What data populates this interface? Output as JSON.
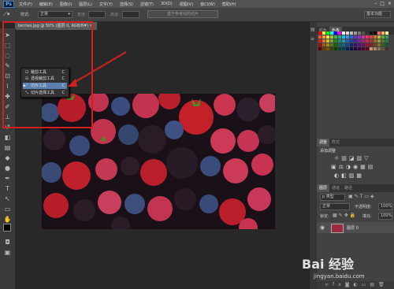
{
  "app": {
    "logo": "Ps"
  },
  "menu": [
    "文件(F)",
    "编辑(E)",
    "图像(I)",
    "图层(L)",
    "文字(Y)",
    "选择(S)",
    "滤镜(T)",
    "3D(D)",
    "视图(V)",
    "窗口(W)",
    "帮助(H)"
  ],
  "window_controls": [
    "–",
    "□",
    "×"
  ],
  "options": {
    "style_label": "样式:",
    "style_value": "正常",
    "width_label": "宽度:",
    "height_label": "高度:",
    "slices_button": "基于参考线的切片",
    "workspace_value": "基本功能"
  },
  "document_tab": {
    "title": "berries.jpg @ 50% (图层 0, RGB/8#) ×"
  },
  "tool_flyout": {
    "items": [
      {
        "label": "裁剪工具",
        "shortcut": "C",
        "icon": "crop-icon",
        "glyph": "⊡",
        "active": false,
        "selected": false
      },
      {
        "label": "透视裁剪工具",
        "shortcut": "C",
        "icon": "perspective-crop-icon",
        "glyph": "⊟",
        "active": false,
        "selected": false
      },
      {
        "label": "切片工具",
        "shortcut": "C",
        "icon": "slice-icon",
        "glyph": "⟋",
        "active": true,
        "selected": true
      },
      {
        "label": "切片选择工具",
        "shortcut": "C",
        "icon": "slice-select-icon",
        "glyph": "⤡",
        "active": false,
        "selected": false
      }
    ]
  },
  "panels": {
    "color_tabs": [
      "颜色",
      "色板"
    ],
    "adjust_tabs": [
      "调整",
      "样式"
    ],
    "adjust_title": "添加调整",
    "layers_tabs": [
      "图层",
      "通道",
      "路径"
    ],
    "kind_label": "p 类型",
    "blend_mode": "正常",
    "opacity_label": "不透明度:",
    "opacity_value": "100%",
    "lock_label": "锁定:",
    "fill_label": "填充:",
    "fill_value": "100%",
    "layer_name": "图层 0"
  },
  "watermark": {
    "brand": "Bai 经验",
    "url": "jingyan.baidu.com"
  },
  "colors": {
    "highlight": "#d02020",
    "selection": "#5b7fb0",
    "foreground": "#000000",
    "background": "#ffffff"
  }
}
